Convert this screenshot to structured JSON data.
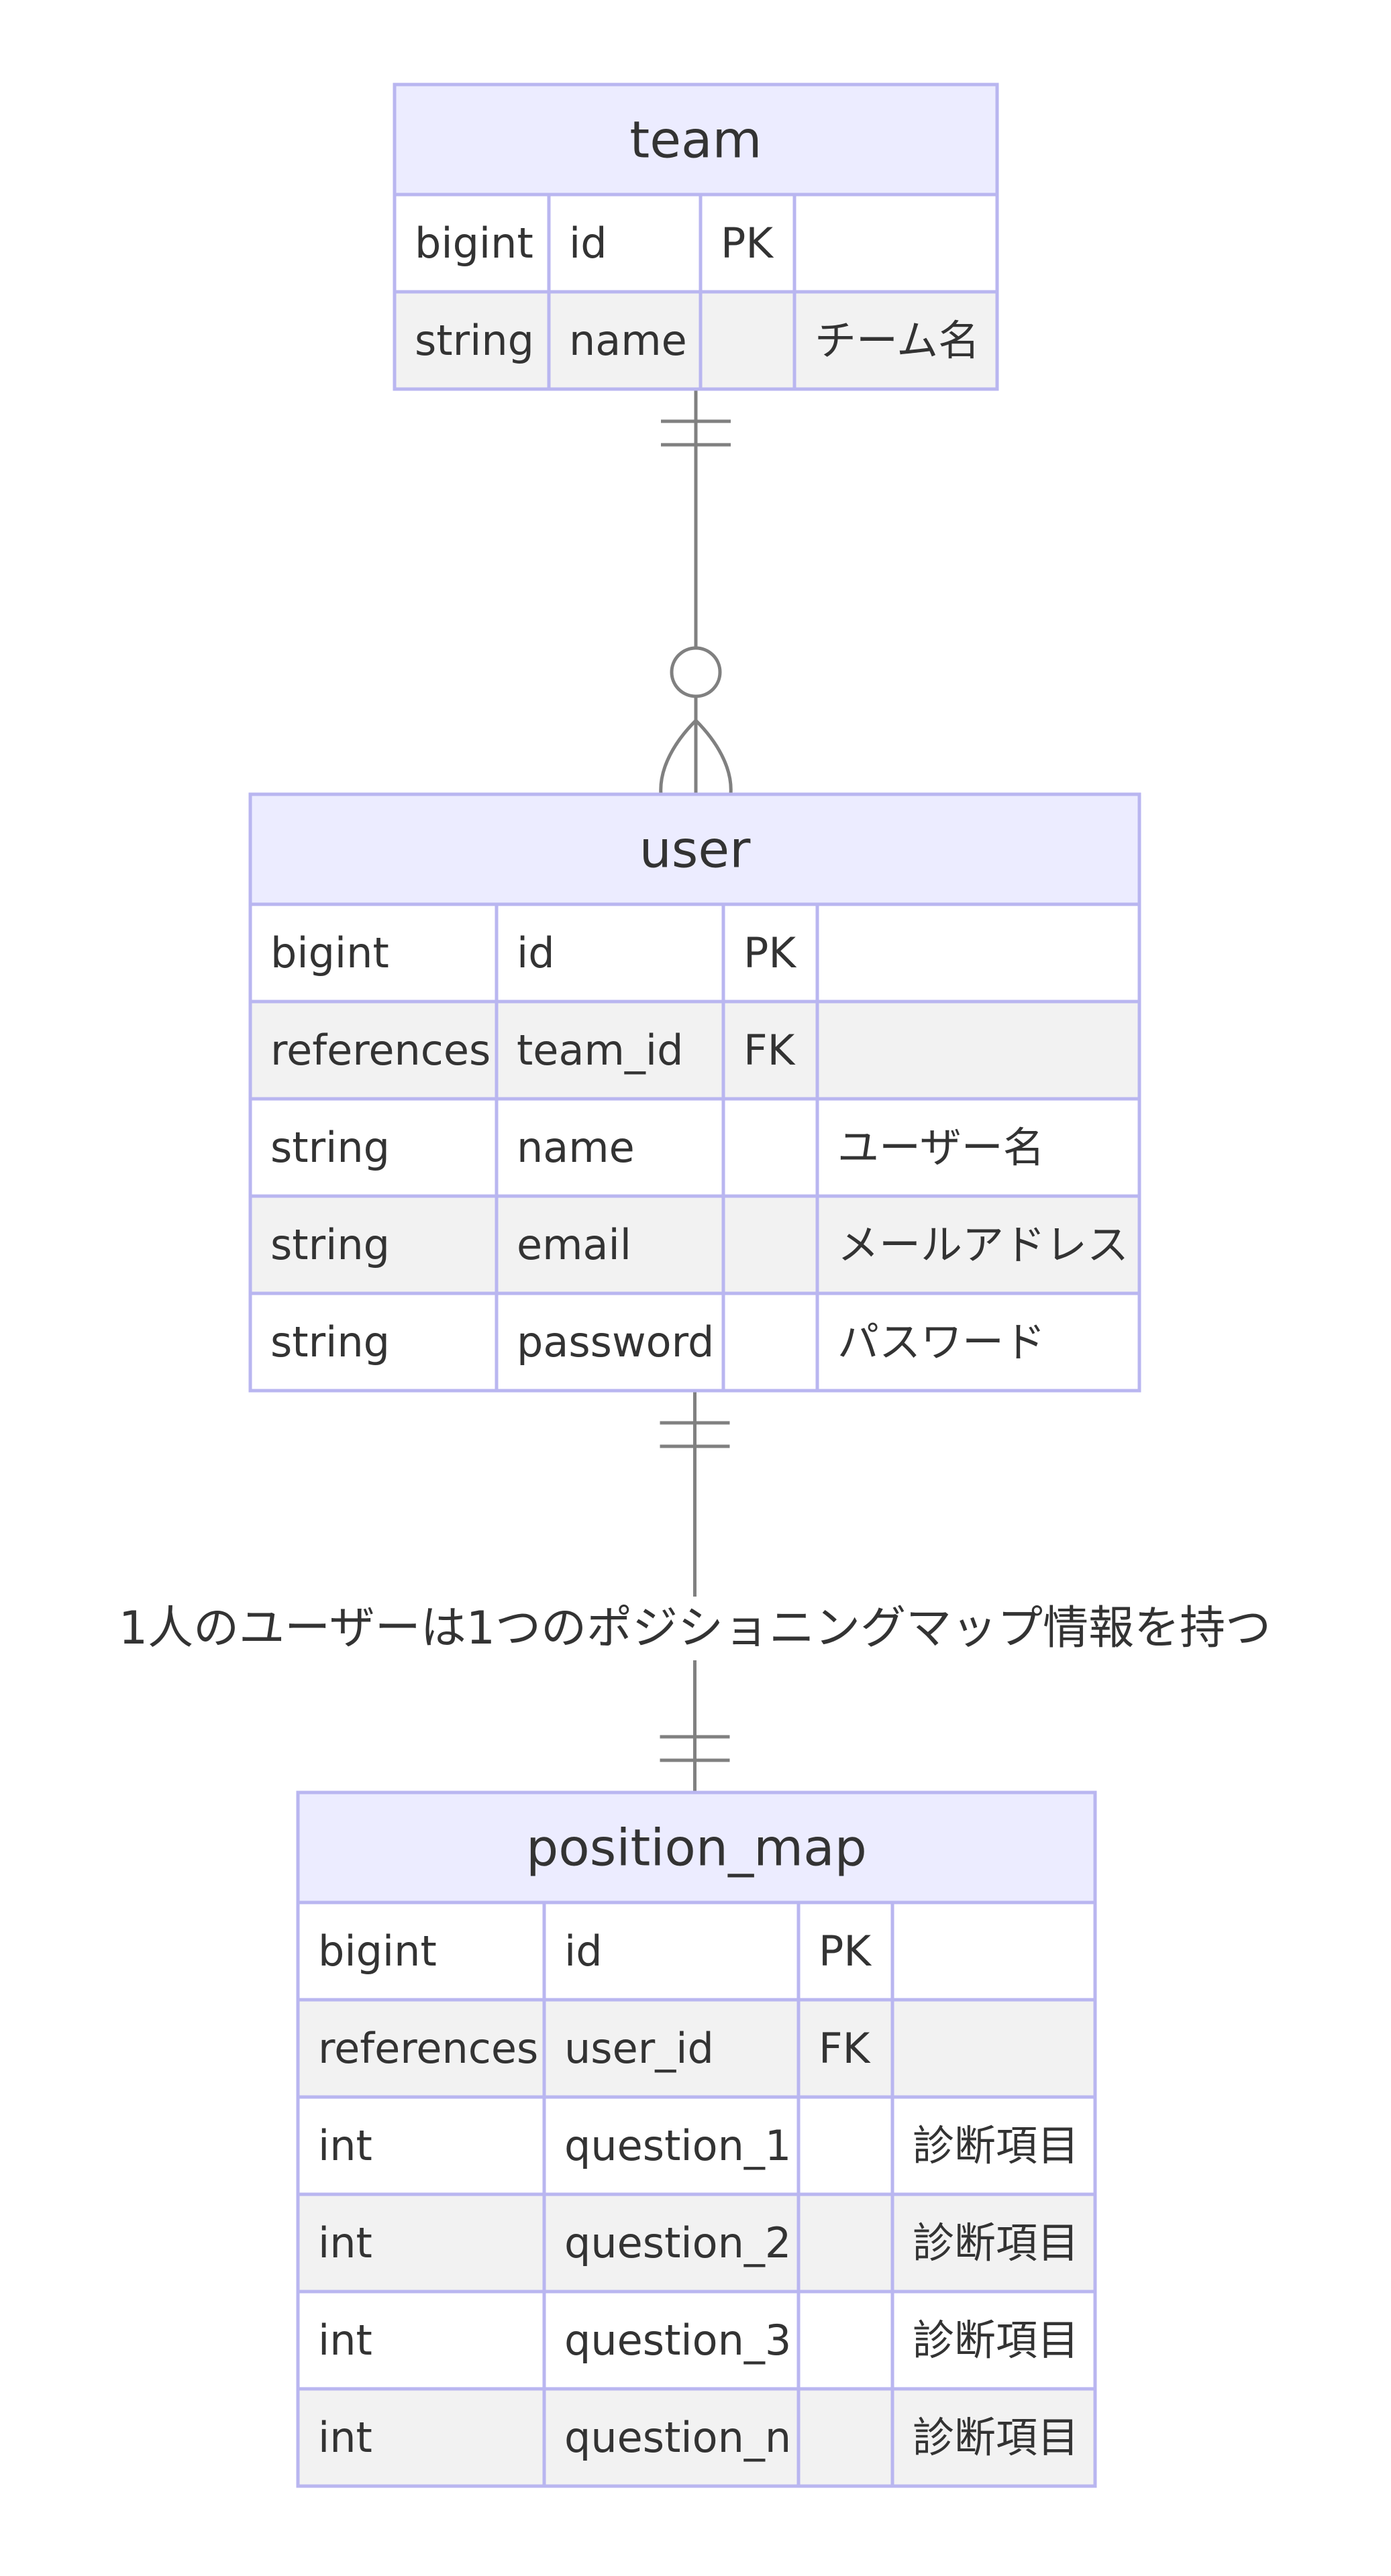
{
  "entities": [
    {
      "name": "team",
      "attributes": [
        {
          "type": "bigint",
          "name": "id",
          "key": "PK",
          "comment": ""
        },
        {
          "type": "string",
          "name": "name",
          "key": "",
          "comment": "チーム名"
        }
      ]
    },
    {
      "name": "user",
      "attributes": [
        {
          "type": "bigint",
          "name": "id",
          "key": "PK",
          "comment": ""
        },
        {
          "type": "references",
          "name": "team_id",
          "key": "FK",
          "comment": ""
        },
        {
          "type": "string",
          "name": "name",
          "key": "",
          "comment": "ユーザー名"
        },
        {
          "type": "string",
          "name": "email",
          "key": "",
          "comment": "メールアドレス"
        },
        {
          "type": "string",
          "name": "password",
          "key": "",
          "comment": "パスワード"
        }
      ]
    },
    {
      "name": "position_map",
      "attributes": [
        {
          "type": "bigint",
          "name": "id",
          "key": "PK",
          "comment": ""
        },
        {
          "type": "references",
          "name": "user_id",
          "key": "FK",
          "comment": ""
        },
        {
          "type": "int",
          "name": "question_1",
          "key": "",
          "comment": "診断項目"
        },
        {
          "type": "int",
          "name": "question_2",
          "key": "",
          "comment": "診断項目"
        },
        {
          "type": "int",
          "name": "question_3",
          "key": "",
          "comment": "診断項目"
        },
        {
          "type": "int",
          "name": "question_n",
          "key": "",
          "comment": "診断項目"
        }
      ]
    }
  ],
  "relationships": [
    {
      "from": "team",
      "to": "user",
      "from_cardinality": "exactly-one",
      "to_cardinality": "zero-or-more",
      "label": ""
    },
    {
      "from": "user",
      "to": "position_map",
      "from_cardinality": "exactly-one",
      "to_cardinality": "exactly-one",
      "label": "1人のユーザーは1つのポジショニングマップ情報を持つ"
    }
  ],
  "colors": {
    "header_fill": "#ececff",
    "border": "#b9b6f0",
    "row_odd": "#ffffff",
    "row_even": "#f2f2f2",
    "line": "#808080",
    "text": "#333333"
  }
}
